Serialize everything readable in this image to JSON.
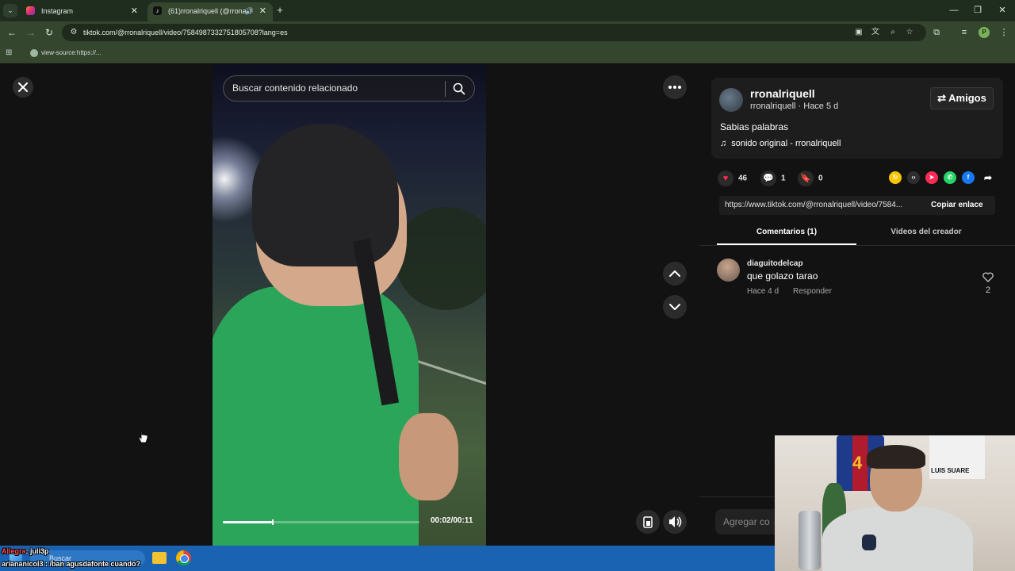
{
  "browser": {
    "tabs": [
      {
        "title": "Instagram",
        "active": false,
        "favicon_color": "#e1306c"
      },
      {
        "title": "(61)rronalriquell (@rronalri",
        "active": true,
        "favicon_color": "#111111"
      }
    ],
    "url": "tiktok.com/@rronalriquell/video/7584987332751805708?lang=es",
    "bookmark": "view-source:https://..."
  },
  "video": {
    "search_placeholder": "Buscar contenido relacionado",
    "time": "00:02/00:11",
    "progress": 0.25
  },
  "post": {
    "username": "rronalriquell",
    "meta": "rronalriquell · Hace 5 d",
    "friends_label": "Amigos",
    "description": "Sabias palabras",
    "sound": "sonido original - rronalriquell",
    "likes": "46",
    "comments": "1",
    "saves": "0",
    "link": "https://www.tiktok.com/@rronalriquell/video/7584...",
    "copy_label": "Copiar enlace",
    "tabs": [
      "Comentarios (1)",
      "Videos del creador"
    ]
  },
  "comment": {
    "user": "diaguitodelcap",
    "text": "que golazo tarao",
    "time": "Hace 4 d",
    "reply": "Responder",
    "likes": "2"
  },
  "add_comment_placeholder": "Agregar co",
  "webcam": {
    "jersey_number": "4",
    "poster_text": "LUIS SUARE"
  },
  "taskbar": {
    "search": "Buscar"
  },
  "chat": [
    {
      "user": "Allegra",
      "text": ": juli3p"
    },
    {
      "user": "ariananicol3",
      "text": " : /ban agusdafonte cuando?"
    }
  ],
  "colors": {
    "like": "#fe2c55",
    "page_bg": "#121212",
    "chrome_theme": "#35462f"
  }
}
